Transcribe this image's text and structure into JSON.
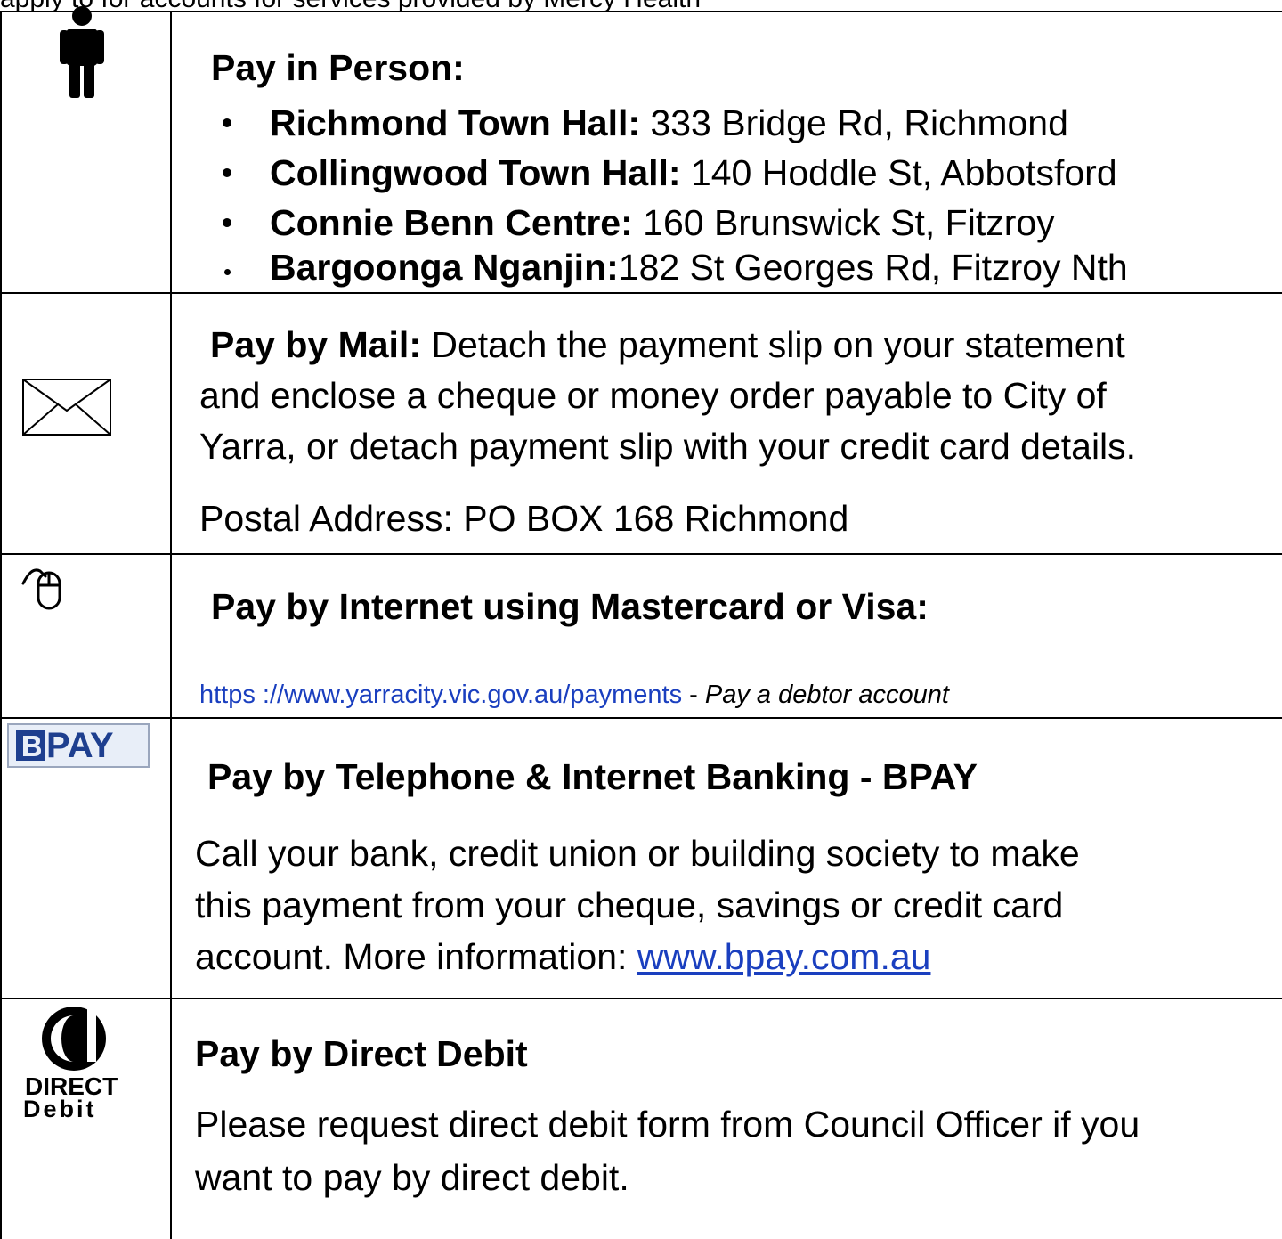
{
  "top_text": "apply to for accounts for services provided by Mercy Health",
  "person": {
    "icon": "person-icon",
    "heading": "Pay in Person:",
    "locations": [
      {
        "name": "Richmond Town Hall:",
        "address": " 333 Bridge Rd, Richmond"
      },
      {
        "name": "Collingwood Town Hall:",
        "address": " 140 Hoddle St, Abbotsford"
      },
      {
        "name": "Connie Benn Centre:",
        "address": " 160 Brunswick St, Fitzroy"
      },
      {
        "name": "Bargoonga Nganjin:",
        "address": "182 St Georges Rd, Fitzroy Nth"
      }
    ]
  },
  "mail": {
    "icon": "envelope-icon",
    "heading": "Pay by Mail:",
    "line1": " Detach the payment slip on your statement",
    "line2": "and enclose a cheque or money order payable to City of",
    "line3": "Yarra, or detach payment slip with your credit card details.",
    "postal": "Postal Address: PO BOX 168 Richmond"
  },
  "internet": {
    "icon": "mouse-icon",
    "heading": "Pay by Internet using Mastercard or Visa:",
    "url": "https ://www.yarracity.vic.gov.au/payments",
    "sep": " - ",
    "note": "Pay a debtor account"
  },
  "bpay": {
    "logo_text": "PAY",
    "heading": "Pay by Telephone & Internet Banking - BPAY",
    "line1": "Call your bank, credit union or building society to make",
    "line2": "this payment from your cheque, savings or credit card",
    "line3_prefix": "account. More information: ",
    "link": "www.bpay.com.au"
  },
  "direct": {
    "logo_line1": "DIRECT",
    "logo_line2": "Debit",
    "heading": "Pay by Direct Debit",
    "line1": "Please request direct debit form from Council Officer if you",
    "line2": "want to pay by direct debit."
  }
}
